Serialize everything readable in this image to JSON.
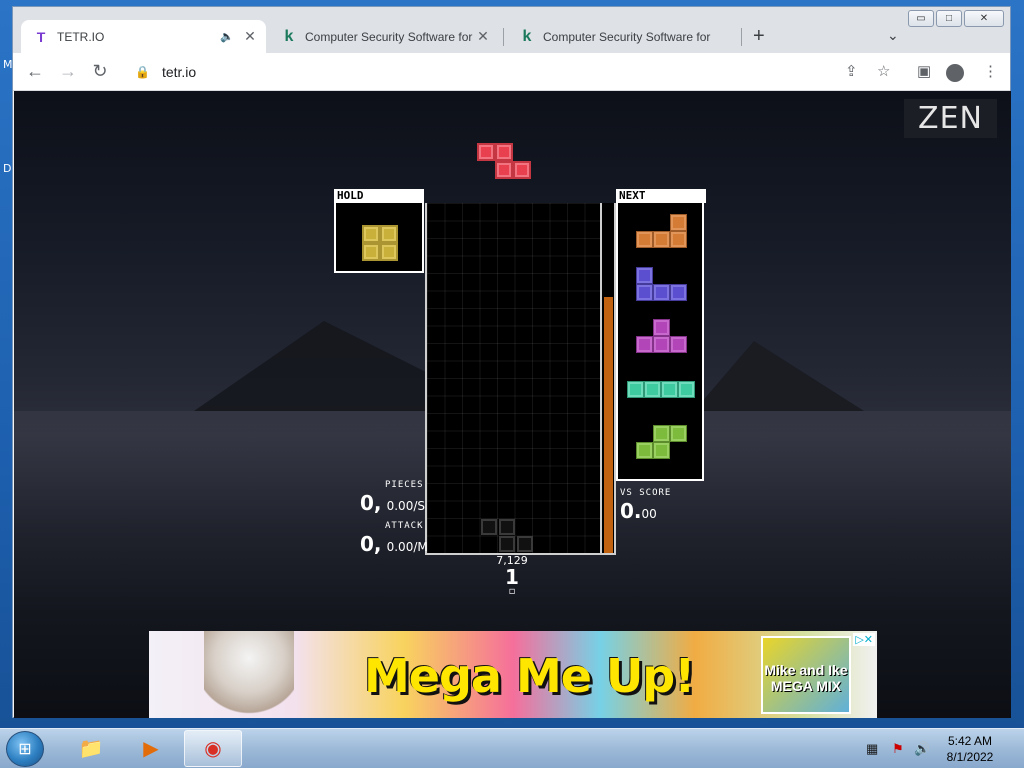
{
  "desktop": {
    "edge_letters": [
      "M",
      "D"
    ]
  },
  "window": {
    "minimize": "▭",
    "maximize": "□",
    "close": "✕"
  },
  "tabs": [
    {
      "title": "TETR.IO",
      "favicon": "T",
      "close": "✕",
      "active": true,
      "audio_icon": "speaker-icon"
    },
    {
      "title": "Computer Security Software for",
      "favicon": "k",
      "close": "✕",
      "active": false
    },
    {
      "title": "Computer Security Software for",
      "favicon": "k",
      "close": "✕",
      "active": false
    }
  ],
  "tabbar": {
    "new_tab": "+",
    "tab_search": "⌄"
  },
  "toolbar": {
    "back": "←",
    "forward": "→",
    "reload": "↻",
    "url": "tetr.io",
    "lock": "🔒",
    "share": "⇪",
    "star": "☆",
    "sidepanel": "▣",
    "menu": "⋮"
  },
  "game": {
    "mode": "ZEN",
    "hold": {
      "label": "HOLD",
      "piece": "O"
    },
    "next": {
      "label": "NEXT",
      "queue": [
        "L",
        "J",
        "T",
        "I",
        "S"
      ]
    },
    "falling_piece": "Z",
    "garbage_meter_fraction": 0.73,
    "stats": {
      "pieces_label": "PIECES",
      "pieces_value": "0,",
      "pieces_rate": "0.00/S",
      "attack_label": "ATTACK",
      "attack_value": "0,",
      "attack_rate": "0.00/M",
      "vs_label": "VS SCORE",
      "vs_value": "0.",
      "vs_decimal": "00"
    },
    "under_board": {
      "score": "7,129",
      "level": "1",
      "progress": "▫"
    }
  },
  "ad": {
    "headline": "Mega Me Up!",
    "product": "Mike and Ike MEGA MIX",
    "choices": "▷✕"
  },
  "taskbar": {
    "start": "⊞",
    "apps": [
      {
        "name": "explorer",
        "icon": "📁"
      },
      {
        "name": "media-player",
        "icon": "▶"
      },
      {
        "name": "chrome",
        "icon": "◉",
        "active": true
      }
    ],
    "tray": [
      "▦",
      "⚑",
      "🔊"
    ],
    "time": "5:42 AM",
    "date": "8/1/2022"
  },
  "colors": {
    "Z": "#e8404f",
    "O": "#c9b03b",
    "L": "#d47b36",
    "J": "#5b4fcf",
    "T": "#b245b8",
    "I": "#3ecb9f",
    "S": "#7dbb3c",
    "meter": "#c0620f"
  }
}
